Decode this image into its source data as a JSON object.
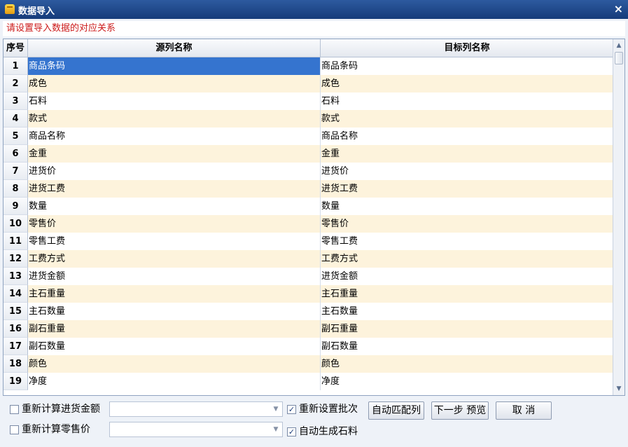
{
  "window": {
    "title": "数据导入",
    "close_glyph": "×"
  },
  "instruction": "请设置导入数据的对应关系",
  "table": {
    "headers": [
      "序号",
      "源列名称",
      "目标列名称"
    ],
    "rows": [
      {
        "no": "1",
        "source": "商品条码",
        "target": "商品条码",
        "selected": true
      },
      {
        "no": "2",
        "source": "成色",
        "target": "成色"
      },
      {
        "no": "3",
        "source": "石料",
        "target": "石料"
      },
      {
        "no": "4",
        "source": "款式",
        "target": "款式"
      },
      {
        "no": "5",
        "source": "商品名称",
        "target": "商品名称"
      },
      {
        "no": "6",
        "source": "金重",
        "target": "金重"
      },
      {
        "no": "7",
        "source": "进货价",
        "target": "进货价"
      },
      {
        "no": "8",
        "source": "进货工费",
        "target": "进货工费"
      },
      {
        "no": "9",
        "source": "数量",
        "target": "数量"
      },
      {
        "no": "10",
        "source": "零售价",
        "target": "零售价"
      },
      {
        "no": "11",
        "source": "零售工费",
        "target": "零售工费"
      },
      {
        "no": "12",
        "source": "工费方式",
        "target": "工费方式"
      },
      {
        "no": "13",
        "source": "进货金额",
        "target": "进货金额"
      },
      {
        "no": "14",
        "source": "主石重量",
        "target": "主石重量"
      },
      {
        "no": "15",
        "source": "主石数量",
        "target": "主石数量"
      },
      {
        "no": "16",
        "source": "副石重量",
        "target": "副石重量"
      },
      {
        "no": "17",
        "source": "副石数量",
        "target": "副石数量"
      },
      {
        "no": "18",
        "source": "颜色",
        "target": "颜色"
      },
      {
        "no": "19",
        "source": "净度",
        "target": "净度"
      }
    ],
    "row_colors": {
      "odd": "#ffffff",
      "even": "#fdf3dc",
      "selected": "#3574cf"
    }
  },
  "footer": {
    "recalc_purchase_amount": {
      "label": "重新计算进货金额",
      "checked": false,
      "value": ""
    },
    "recalc_retail_price": {
      "label": "重新计算零售价",
      "checked": false,
      "value": ""
    },
    "reset_batch": {
      "label": "重新设置批次",
      "checked": true
    },
    "auto_generate_stone": {
      "label": "自动生成石料",
      "checked": true
    },
    "auto_match_button": "自动匹配列",
    "next_preview_button": "下一步 预览",
    "cancel_button": "取 消"
  },
  "icons": [
    "app-icon",
    "close-icon",
    "scroll-up-icon",
    "scroll-down-icon",
    "dropdown-arrow-icon",
    "checkmark-icon"
  ]
}
